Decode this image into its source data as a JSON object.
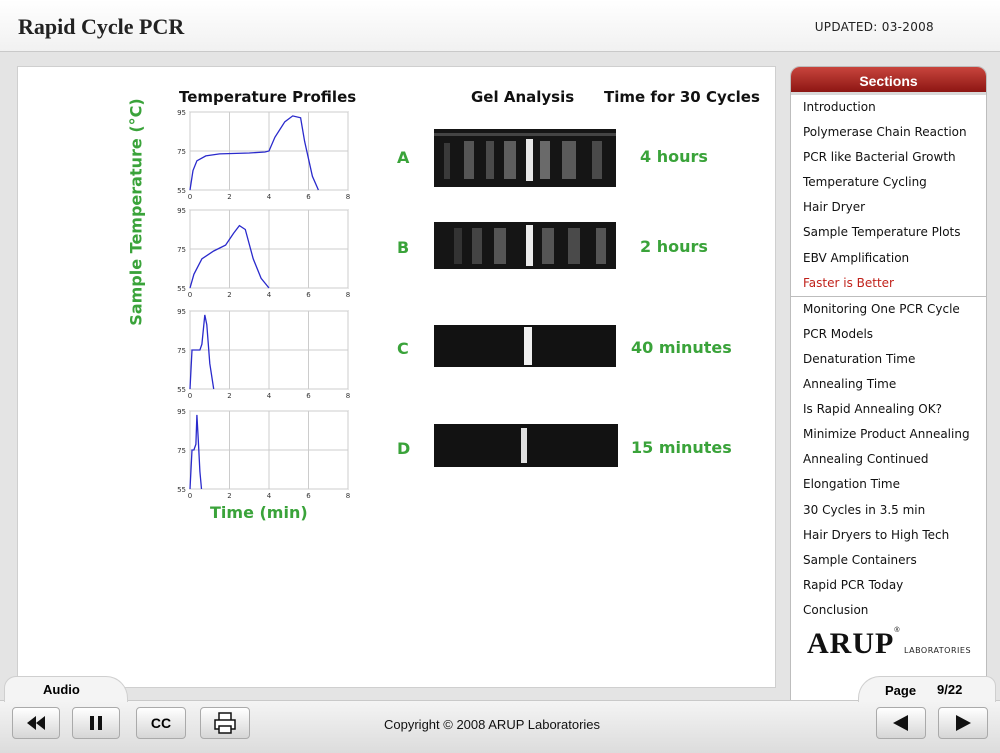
{
  "header": {
    "title": "Rapid Cycle PCR",
    "updated": "UPDATED: 03-2008"
  },
  "content": {
    "profiles_heading": "Temperature Profiles",
    "gel_heading": "Gel Analysis",
    "time_heading": "Time for 30 Cycles",
    "y_axis_label": "Sample Temperature (°C)",
    "x_axis_label": "Time (min)",
    "rows": [
      {
        "letter": "A",
        "time": "4 hours"
      },
      {
        "letter": "B",
        "time": "2 hours"
      },
      {
        "letter": "C",
        "time": "40 minutes"
      },
      {
        "letter": "D",
        "time": "15 minutes"
      }
    ]
  },
  "chart_data": {
    "type": "line",
    "xlabel": "Time (min)",
    "ylabel": "Sample Temperature (°C)",
    "x_ticks": [
      "0",
      "2",
      "4",
      "6",
      "8"
    ],
    "y_ticks": [
      "55",
      "75",
      "95"
    ],
    "xlim": [
      0,
      8
    ],
    "ylim": [
      55,
      95
    ],
    "grid": true,
    "panels": [
      {
        "label": "A",
        "x": [
          0,
          0.15,
          0.35,
          0.8,
          1.5,
          3.0,
          3.8,
          4.0,
          4.3,
          4.8,
          5.2,
          5.6,
          5.8,
          6.2,
          6.5
        ],
        "y": [
          55,
          65,
          70,
          72.5,
          73.5,
          74,
          74.5,
          75,
          82,
          90,
          93,
          92,
          80,
          62,
          55
        ]
      },
      {
        "label": "B",
        "x": [
          0,
          0.2,
          0.6,
          1.2,
          1.8,
          2.2,
          2.5,
          2.8,
          3.2,
          3.6,
          4.0
        ],
        "y": [
          55,
          62,
          70,
          74,
          77,
          83,
          87,
          85,
          70,
          60,
          55
        ]
      },
      {
        "label": "C",
        "x": [
          0,
          0.1,
          0.5,
          0.6,
          0.75,
          0.85,
          1.0,
          1.2
        ],
        "y": [
          55,
          75,
          75,
          78,
          93,
          88,
          68,
          55
        ]
      },
      {
        "label": "D",
        "x": [
          0,
          0.1,
          0.2,
          0.3,
          0.35,
          0.42,
          0.5,
          0.58
        ],
        "y": [
          55,
          75,
          75,
          78,
          93,
          80,
          64,
          55
        ]
      }
    ]
  },
  "sidebar": {
    "title": "Sections",
    "items": [
      "Introduction",
      "Polymerase Chain Reaction",
      "PCR like Bacterial Growth",
      "Temperature Cycling",
      "Hair Dryer",
      "Sample Temperature Plots",
      "EBV Amplification",
      "Faster is Better",
      "Monitoring One PCR Cycle",
      "PCR Models",
      "Denaturation Time",
      "Annealing Time",
      "Is Rapid Annealing OK?",
      "Minimize Product Annealing",
      "Annealing Continued",
      "Elongation Time",
      "30 Cycles in 3.5 min",
      "Hair Dryers to High Tech",
      "Sample Containers",
      "Rapid PCR Today",
      "Conclusion"
    ],
    "active_item": "Faster is Better",
    "logo_text": "ARUP",
    "logo_sub": "LABORATORIES"
  },
  "footer": {
    "audio_tab": "Audio",
    "cc_label": "CC",
    "copyright": "Copyright © 2008 ARUP Laboratories",
    "page_label": "Page",
    "page_number": "9/22"
  },
  "colors": {
    "accent_green": "#3aa33a",
    "sidebar_header": "#a8231f",
    "active_item": "#c0211a",
    "curve": "#2a2acc"
  }
}
